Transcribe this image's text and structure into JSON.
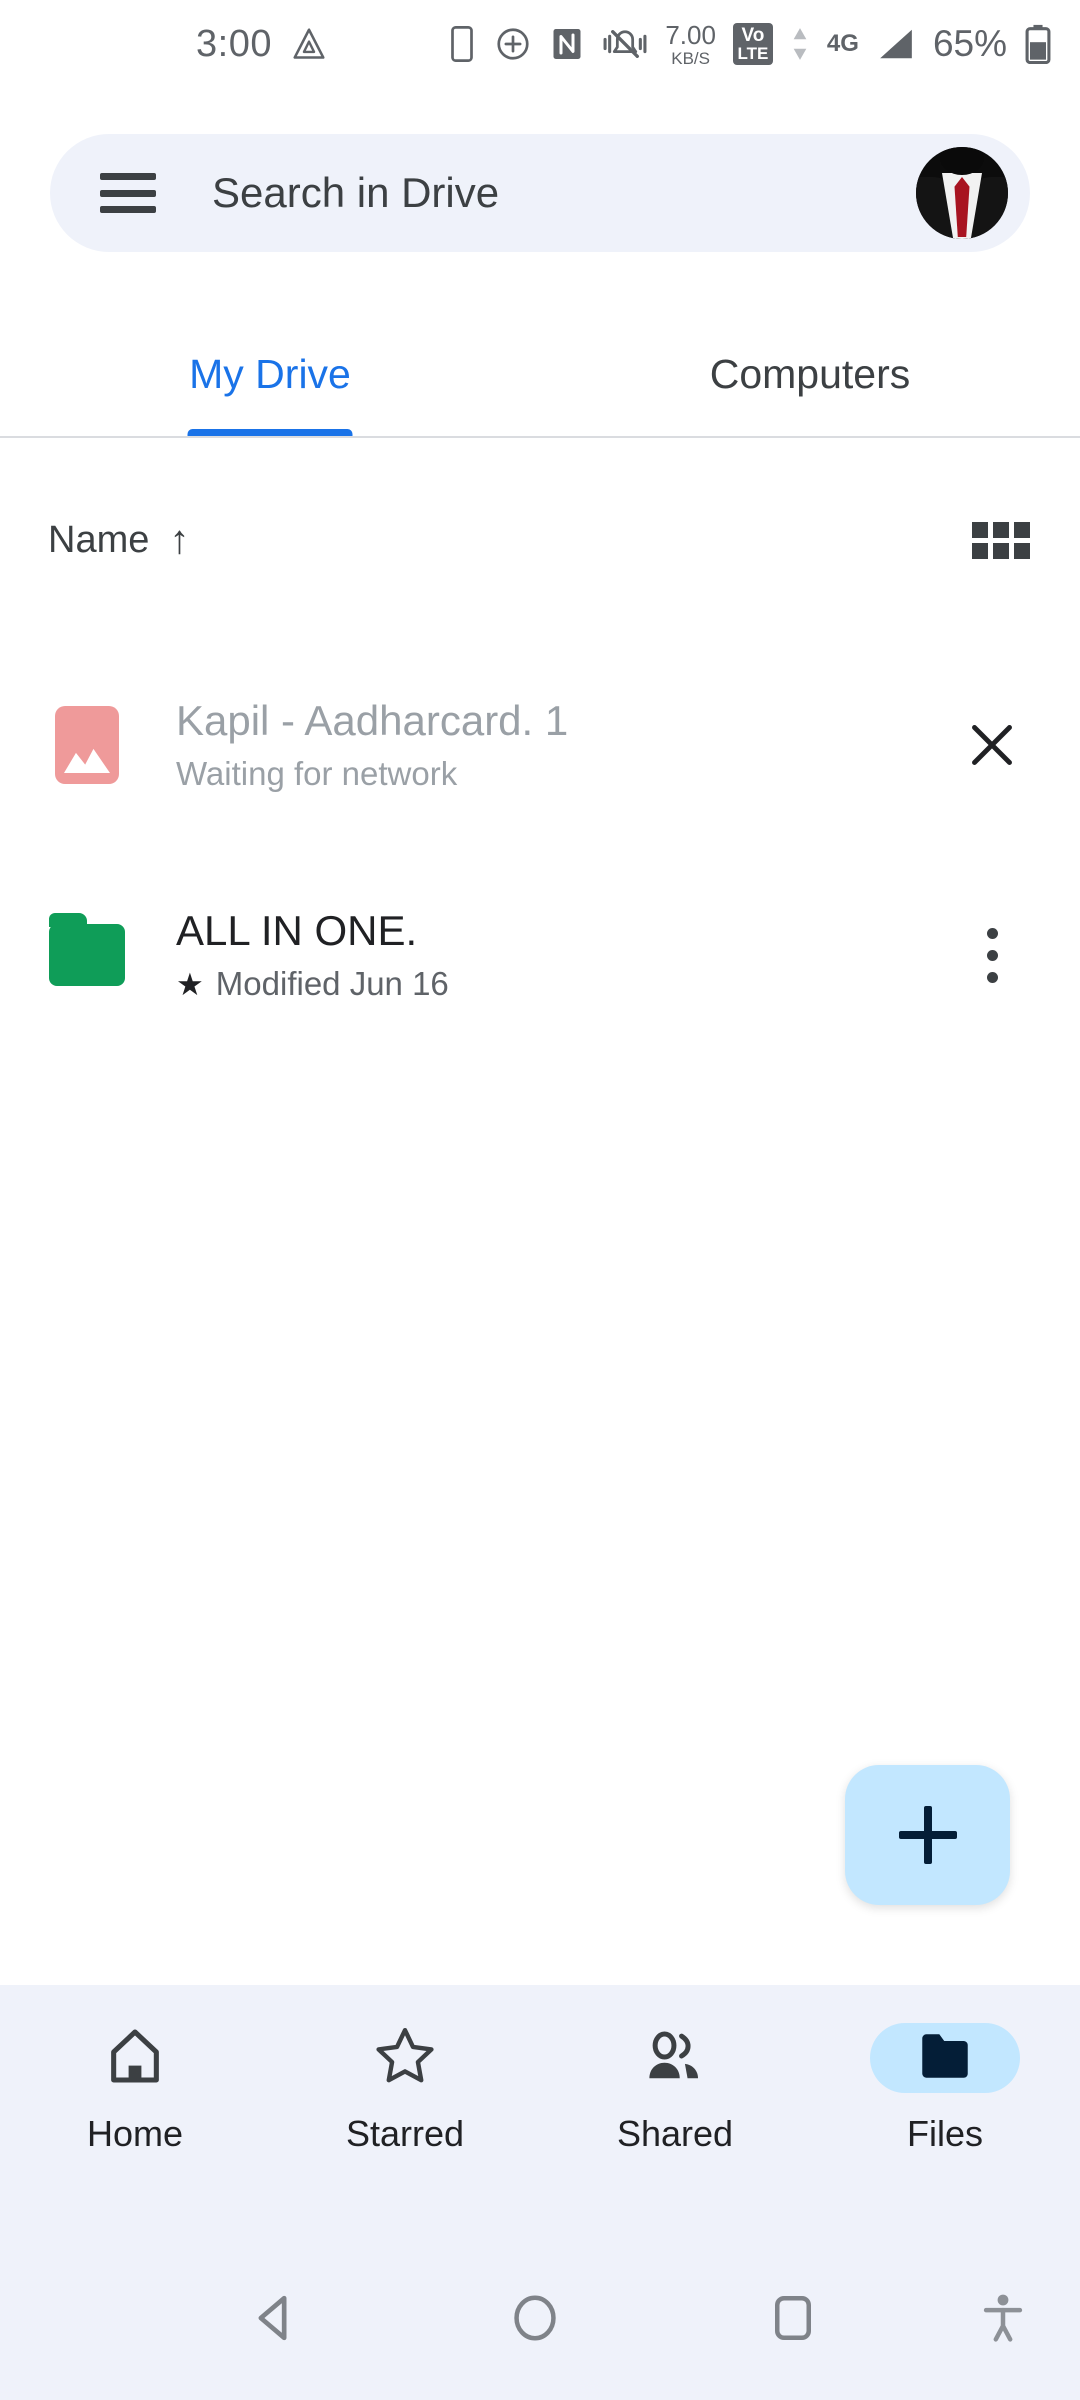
{
  "status_bar": {
    "time": "3:00",
    "left_icons": [
      "adobe-triangle-icon"
    ],
    "right_icons": [
      "phone-icon",
      "circled-plus-icon",
      "nfc-icon",
      "vibrate-mute-icon"
    ],
    "network_speed_value": "7.00",
    "network_speed_unit": "KB/S",
    "volte_line1": "Vo",
    "volte_line2": "LTE",
    "network_type": "4G",
    "battery_percent": "65%"
  },
  "search": {
    "placeholder": "Search in Drive",
    "menu_icon": "hamburger-menu-icon",
    "avatar_label": "account-avatar"
  },
  "tabs": [
    {
      "label": "My Drive",
      "active": true
    },
    {
      "label": "Computers",
      "active": false
    }
  ],
  "sort": {
    "label": "Name",
    "direction_glyph": "↑",
    "view_toggle_icon": "grid-view-icon"
  },
  "files": [
    {
      "title": "Kapil - Aadharcard. 1",
      "subtitle": "Waiting for network",
      "icon": "image-file-icon",
      "icon_color": "#ef9a9a",
      "starred": false,
      "muted": true,
      "action_icon": "close-icon"
    },
    {
      "title": "ALL IN ONE.",
      "subtitle": "Modified Jun 16",
      "icon": "folder-icon",
      "icon_color": "#0f9d58",
      "starred": true,
      "star_glyph": "★",
      "muted": false,
      "action_icon": "more-vert-icon"
    }
  ],
  "fab": {
    "label": "+",
    "icon": "plus-icon",
    "color": "#c2e7ff"
  },
  "bottom_nav": [
    {
      "label": "Home",
      "icon": "home-icon",
      "active": false
    },
    {
      "label": "Starred",
      "icon": "star-icon",
      "active": false
    },
    {
      "label": "Shared",
      "icon": "people-icon",
      "active": false
    },
    {
      "label": "Files",
      "icon": "folder-icon",
      "active": true
    }
  ],
  "android_nav": [
    {
      "name": "back-button",
      "icon": "triangle-back-icon"
    },
    {
      "name": "home-button",
      "icon": "circle-home-icon"
    },
    {
      "name": "recents-button",
      "icon": "square-recents-icon"
    },
    {
      "name": "accessibility-button",
      "icon": "accessibility-icon"
    }
  ],
  "colors": {
    "accent_blue": "#1a73e8",
    "surface": "#eff2fa",
    "fab": "#c2e7ff",
    "folder_green": "#0f9d58",
    "image_salmon": "#ef9a9a"
  }
}
